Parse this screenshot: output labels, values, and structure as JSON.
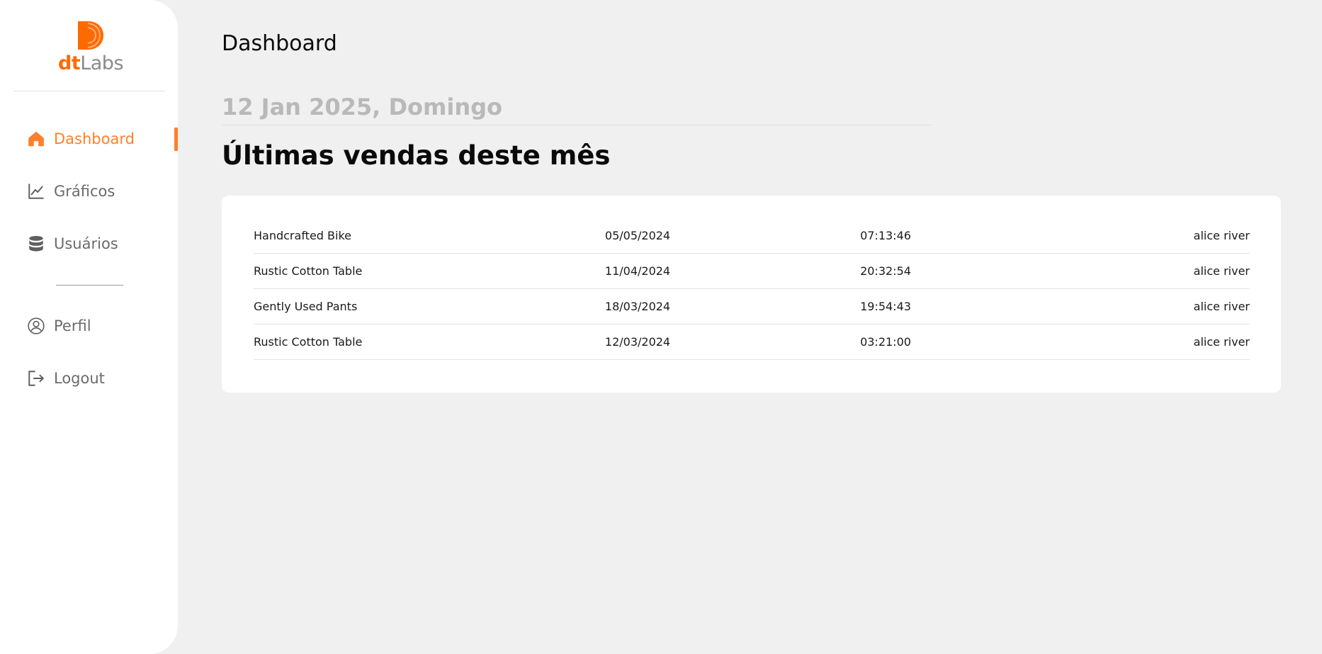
{
  "brand": {
    "logo_dt": "dt",
    "logo_labs": "Labs",
    "accent": "#ff7f2a"
  },
  "sidebar": {
    "items": [
      {
        "label": "Dashboard",
        "icon": "home-icon",
        "active": true
      },
      {
        "label": "Gráficos",
        "icon": "line-chart-icon",
        "active": false
      },
      {
        "label": "Usuários",
        "icon": "database-icon",
        "active": false
      }
    ],
    "bottom_items": [
      {
        "label": "Perfil",
        "icon": "user-circle-icon"
      },
      {
        "label": "Logout",
        "icon": "logout-icon"
      }
    ]
  },
  "header": {
    "title": "Dashboard"
  },
  "main": {
    "date": "12 Jan 2025, Domingo",
    "section_title": "Últimas vendas deste mês",
    "sales": [
      {
        "product": "Handcrafted Bike",
        "date": "05/05/2024",
        "time": "07:13:46",
        "user": "alice river"
      },
      {
        "product": "Rustic Cotton Table",
        "date": "11/04/2024",
        "time": "20:32:54",
        "user": "alice river"
      },
      {
        "product": "Gently Used Pants",
        "date": "18/03/2024",
        "time": "19:54:43",
        "user": "alice river"
      },
      {
        "product": "Rustic Cotton Table",
        "date": "12/03/2024",
        "time": "03:21:00",
        "user": "alice river"
      }
    ]
  }
}
